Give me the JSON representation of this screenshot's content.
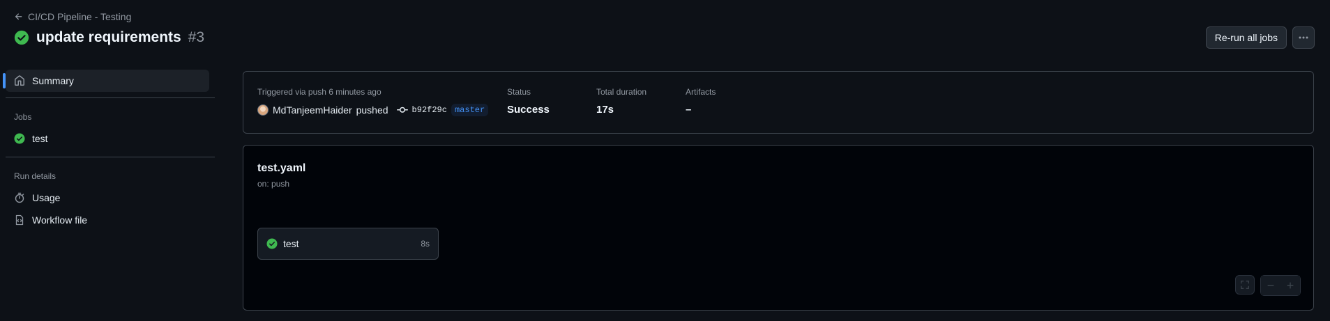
{
  "header": {
    "back_label": "CI/CD Pipeline - Testing",
    "title": "update requirements",
    "run_number": "#3",
    "rerun_label": "Re-run all jobs"
  },
  "sidebar": {
    "summary_label": "Summary",
    "jobs_section": "Jobs",
    "jobs": [
      {
        "label": "test",
        "status": "success"
      }
    ],
    "run_details_section": "Run details",
    "usage_label": "Usage",
    "workflow_file_label": "Workflow file"
  },
  "summary": {
    "trigger_text": "Triggered via push 6 minutes ago",
    "actor": "MdTanjeemHaider",
    "action": "pushed",
    "commit_sha": "b92f29c",
    "branch": "master",
    "status_label": "Status",
    "status_value": "Success",
    "duration_label": "Total duration",
    "duration_value": "17s",
    "artifacts_label": "Artifacts",
    "artifacts_value": "–"
  },
  "workflow": {
    "file_name": "test.yaml",
    "trigger": "on: push",
    "job": {
      "label": "test",
      "duration": "8s"
    }
  },
  "colors": {
    "success": "#3fb950",
    "accent": "#4493f8",
    "background": "#0d1117"
  }
}
